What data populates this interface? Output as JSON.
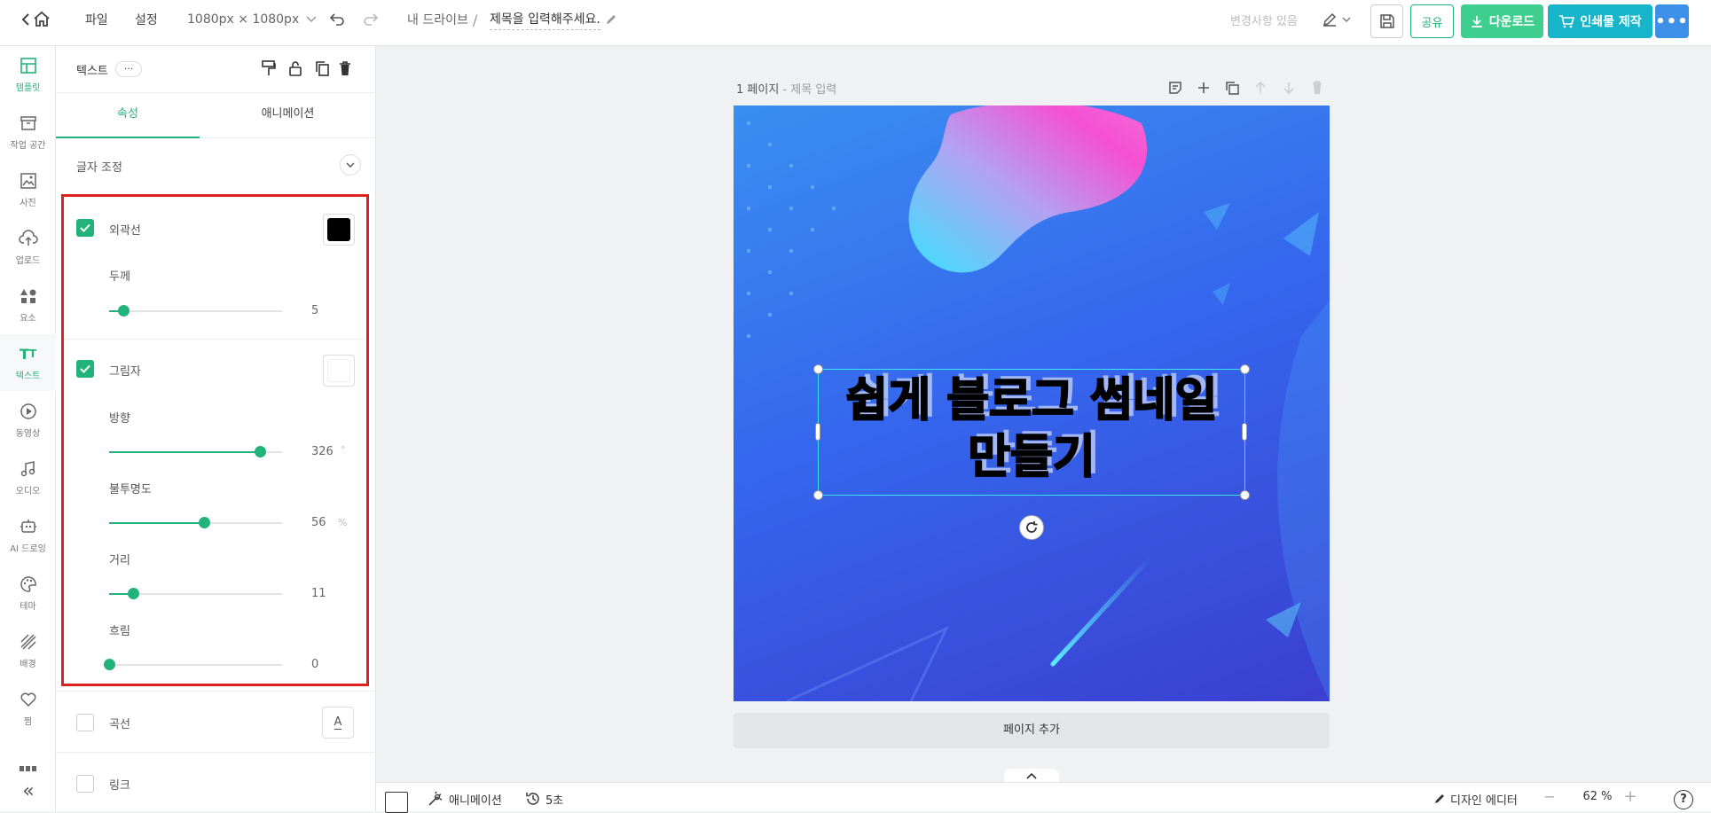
{
  "topbar": {
    "file": "파일",
    "settings": "설정",
    "size": "1080px × 1080px",
    "drive": "내 드라이브",
    "separator": "/",
    "title_placeholder": "제목을 입력해주세요.",
    "change_status": "변경사항 있음",
    "share": "공유",
    "download": "다운로드",
    "print": "인쇄물 제작"
  },
  "sidebar": {
    "items": [
      {
        "label": "템플릿",
        "icon": "template-icon"
      },
      {
        "label": "작업 공간",
        "icon": "workspace-icon"
      },
      {
        "label": "사진",
        "icon": "photo-icon"
      },
      {
        "label": "업로드",
        "icon": "upload-icon"
      },
      {
        "label": "요소",
        "icon": "elements-icon"
      },
      {
        "label": "텍스트",
        "icon": "text-icon"
      },
      {
        "label": "동영상",
        "icon": "video-icon"
      },
      {
        "label": "오디오",
        "icon": "audio-icon"
      },
      {
        "label": "AI 드로잉",
        "icon": "ai-drawing-icon"
      },
      {
        "label": "테마",
        "icon": "theme-icon"
      },
      {
        "label": "배경",
        "icon": "background-icon"
      },
      {
        "label": "찜",
        "icon": "heart-icon"
      }
    ],
    "collapse": "«"
  },
  "panel": {
    "title": "텍스트",
    "more": "···",
    "tabs": [
      "속성",
      "애니메이션"
    ],
    "letter_adjust": "글자 조정",
    "outline": {
      "label": "외곽선",
      "checked": true,
      "color": "#000000",
      "thickness_label": "두께",
      "thickness": 5,
      "thickness_fraction": 0.08
    },
    "shadow": {
      "label": "그림자",
      "checked": true,
      "color": "#ffffff",
      "direction_label": "방향",
      "direction": 326,
      "direction_unit": "°",
      "direction_fraction": 0.87,
      "opacity_label": "불투명도",
      "opacity": 56,
      "opacity_unit": "%",
      "opacity_fraction": 0.55,
      "distance_label": "거리",
      "distance": 11,
      "distance_fraction": 0.14,
      "blur_label": "흐림",
      "blur": 0,
      "blur_fraction": 0.0
    },
    "curve": {
      "label": "곡선",
      "checked": false,
      "icon_text": "A"
    },
    "link": {
      "label": "링크",
      "checked": false
    }
  },
  "canvas": {
    "page_label": "1 페이지",
    "page_sep": " - ",
    "page_title": "제목 입력",
    "headline_line1": "쉽게 블로그 썸네일",
    "headline_line2": "만들기",
    "add_page": "페이지 추가"
  },
  "bottombar": {
    "animation": "애니메이션",
    "duration": "5초",
    "design_editor": "디자인 에디터",
    "zoom": "62 %",
    "minus": "−",
    "plus": "+",
    "help": "?"
  },
  "colors": {
    "accent": "#22b27b",
    "download": "#3ecf8e",
    "print": "#17b5c9",
    "more": "#3d8fe8",
    "highlight": "#e02020"
  }
}
